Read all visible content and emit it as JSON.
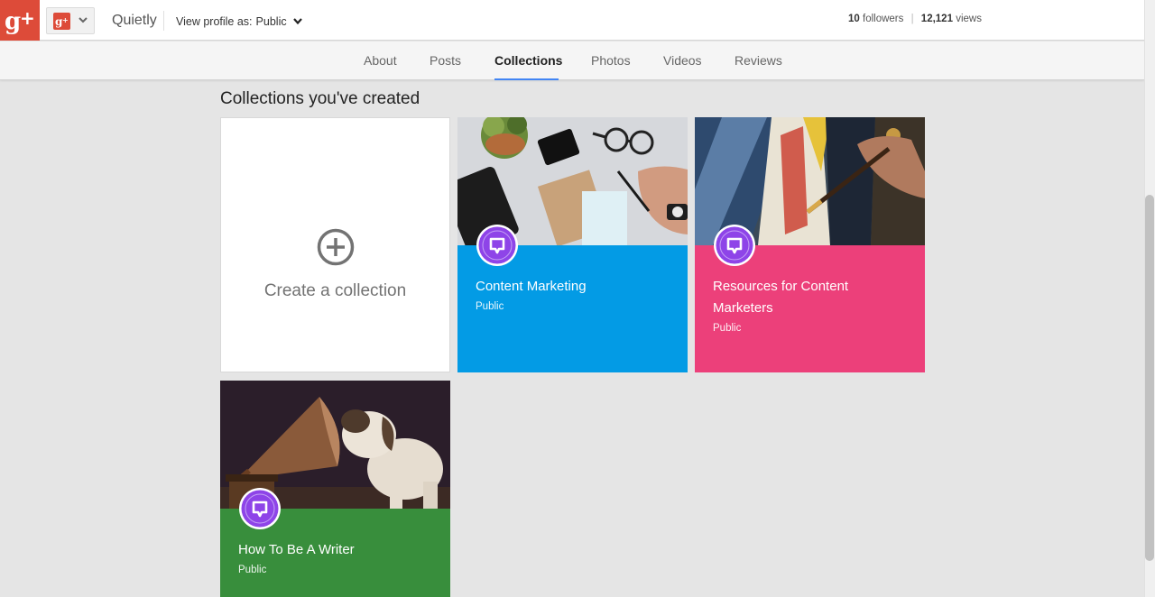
{
  "header": {
    "brand": "Quietly",
    "view_as_label": "View profile as:",
    "view_as_value": "Public",
    "followers_count": "10",
    "followers_label": "followers",
    "views_count": "12,121",
    "views_label": "views",
    "logo_icon": "google-plus-icon",
    "separator": "|"
  },
  "tabs": [
    {
      "label": "About",
      "active": false
    },
    {
      "label": "Posts",
      "active": false
    },
    {
      "label": "Collections",
      "active": true
    },
    {
      "label": "Photos",
      "active": false
    },
    {
      "label": "Videos",
      "active": false
    },
    {
      "label": "Reviews",
      "active": false
    }
  ],
  "main": {
    "heading": "Collections you've created",
    "create_label": "Create a collection",
    "create_icon": "plus-circle-icon",
    "collections": [
      {
        "title": "Content Marketing",
        "visibility": "Public",
        "color": "#039be5",
        "cover": "desk-with-phone-glasses-notebook"
      },
      {
        "title": "Resources for Content Marketers",
        "visibility": "Public",
        "color": "#ec407a",
        "cover": "hand-painting-canvas"
      },
      {
        "title": "How To Be A Writer",
        "visibility": "Public",
        "color": "#388e3c",
        "cover": "dog-listening-to-gramophone"
      }
    ]
  },
  "colors": {
    "gplus_red": "#dd4b39",
    "tab_underline": "#4285f4",
    "avatar_purple": "#8e44e8"
  }
}
